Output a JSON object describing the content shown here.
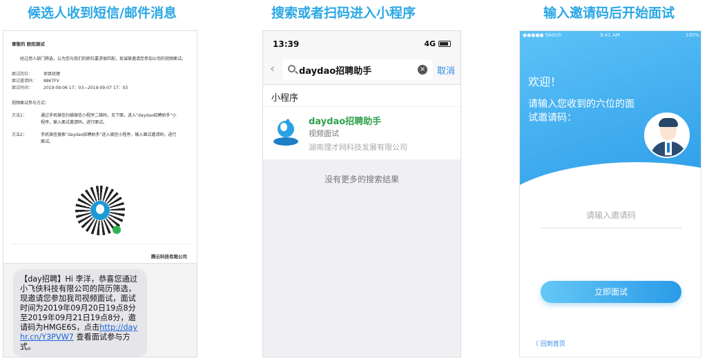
{
  "headings": [
    "候选人收到短信/邮件消息",
    "搜索或者扫码进入小程序",
    "输入邀请码后开始面试"
  ],
  "email": {
    "greeting": "尊敬的 欧阳测试",
    "intro": "经过用人部门筛选，认为您与我们的职位要求很匹配，现诚挚邀请您参加公司的视频面试。",
    "fields": [
      {
        "key": "面试岗位：",
        "value": "项目经理"
      },
      {
        "key": "面试邀请码：",
        "value": "886TFV"
      },
      {
        "key": "面试时间：",
        "value": "2019-09-06 17：03—2019-09-07 17：03"
      }
    ],
    "methods_title": "视频面试参与方式：",
    "methods": [
      {
        "key": "方法1：",
        "value": "通过手机微信扫描微信小程序二维码，见下面，进入“daydao招聘助手”小程序，输入面试邀请码，进行面试。"
      },
      {
        "key": "方法2：",
        "value": "手机微信搜索“daydao招聘助手”进入微信小程序，输入面试邀请码，进行面试。"
      }
    ],
    "company": "腾云科技有限公司"
  },
  "sms": {
    "text": "【day招聘】Hi 李洋，恭喜您通过小飞侠科技有限公司的简历筛选，现邀请您参加我司视频面试，面试时间为2019年09月20日19点8分至2019年09月21日19点8分，邀请码为HMGE6S，点击",
    "link": "http://dayhr.cn/Y3PVW7",
    "suffix": " 查看面试参与方式。"
  },
  "phone": {
    "time": "13:39",
    "signal": "4G",
    "search_query": "daydao招聘助手",
    "cancel": "取消",
    "section": "小程序",
    "result": {
      "name": "daydao招聘助手",
      "category": "视频面试",
      "org": "湖南理才网科技发展有限公司"
    },
    "no_more": "没有更多的搜索结果",
    "icons": [
      "back-icon",
      "search-icon",
      "clear-icon",
      "miniapp-logo-icon"
    ]
  },
  "app": {
    "status_left": "●●●●● Sketch",
    "status_time": "9:41 AM",
    "status_right": "100%",
    "welcome": "欢迎！",
    "prompt": "请输入您收到的六位的面试邀请码：",
    "input_placeholder": "请输入邀请码",
    "start_button": "立即面试",
    "home_link": "〈 回到首页"
  },
  "colors": {
    "accent": "#2aa7e4",
    "wechat_green": "#2fa04b",
    "ios_link": "#2c8be6"
  }
}
